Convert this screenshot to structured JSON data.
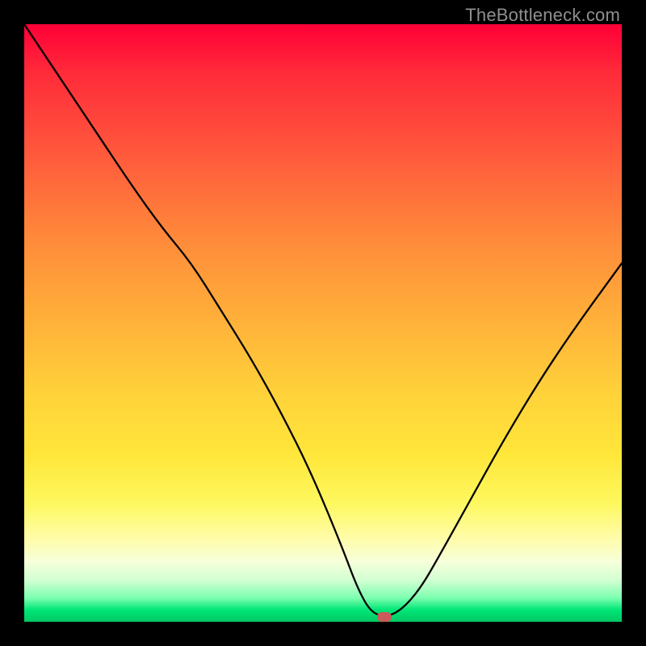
{
  "watermark": "TheBottleneck.com",
  "marker": {
    "x_frac": 0.603,
    "y_frac": 0.992
  },
  "chart_data": {
    "type": "line",
    "title": "",
    "xlabel": "",
    "ylabel": "",
    "xlim": [
      0,
      1
    ],
    "ylim": [
      0,
      1
    ],
    "series": [
      {
        "name": "curve",
        "x": [
          0.0,
          0.06,
          0.12,
          0.18,
          0.23,
          0.28,
          0.33,
          0.38,
          0.43,
          0.48,
          0.53,
          0.56,
          0.585,
          0.62,
          0.66,
          0.7,
          0.75,
          0.8,
          0.86,
          0.92,
          1.0
        ],
        "y": [
          1.0,
          0.91,
          0.82,
          0.73,
          0.66,
          0.6,
          0.52,
          0.44,
          0.35,
          0.25,
          0.13,
          0.05,
          0.01,
          0.01,
          0.05,
          0.12,
          0.21,
          0.3,
          0.4,
          0.49,
          0.6
        ]
      }
    ],
    "annotations": [
      {
        "type": "marker",
        "shape": "pill",
        "x": 0.603,
        "y": 0.008,
        "color": "#cc5a5a"
      }
    ]
  }
}
